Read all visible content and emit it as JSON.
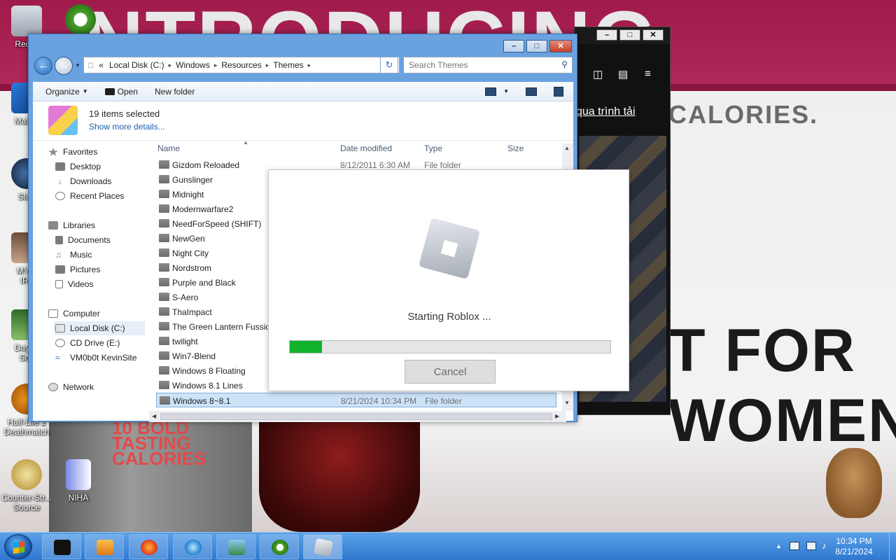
{
  "desktop": {
    "icons": [
      {
        "label": "Recyc",
        "icon": "recycle-bin-icon"
      },
      {
        "label": "Malwa",
        "icon": "malwarebytes-icon"
      },
      {
        "label": "Stea",
        "icon": "steam-icon"
      },
      {
        "label": "MY F\nIRL",
        "icon": "user-photo-icon"
      },
      {
        "label": "Day of\nSou",
        "icon": "day-of-defeat-icon"
      },
      {
        "label": "Half-Life 2\nDeathmatch",
        "icon": "half-life-icon"
      },
      {
        "label": "Counter-Str...\nSource",
        "icon": "counter-strike-icon"
      },
      {
        "label": "NIHA",
        "icon": "file-icon"
      }
    ],
    "wallpaper": {
      "top_text": "NTRODUCING",
      "calories_text": "CALORIES.",
      "for_text": "T FOR",
      "women_text": "WOMEN.",
      "can_text": "10 BOLD\nTASTING\nCALORIES"
    }
  },
  "browser_window": {
    "link_text": "qua trình tải"
  },
  "explorer": {
    "address": {
      "segments": [
        "Local Disk (C:)",
        "Windows",
        "Resources",
        "Themes"
      ],
      "overflow": "«"
    },
    "search_placeholder": "Search Themes",
    "toolbar": {
      "organize": "Organize",
      "open": "Open",
      "new_folder": "New folder"
    },
    "details": {
      "count": "19 items selected",
      "show_more": "Show more details..."
    },
    "nav": {
      "favorites": "Favorites",
      "desktop": "Desktop",
      "downloads": "Downloads",
      "recent": "Recent Places",
      "libraries": "Libraries",
      "documents": "Documents",
      "music": "Music",
      "pictures": "Pictures",
      "videos": "Videos",
      "computer": "Computer",
      "local_disk": "Local Disk (C:)",
      "cd_drive": "CD Drive (E:)",
      "network_share": "VM0b0t KevinSite",
      "network": "Network"
    },
    "columns": {
      "name": "Name",
      "date": "Date modified",
      "type": "Type",
      "size": "Size"
    },
    "files": [
      {
        "name": "Gizdom Reloaded",
        "date": "8/12/2011 6:30 AM",
        "type": "File folder"
      },
      {
        "name": "Gunslinger",
        "date": "",
        "type": ""
      },
      {
        "name": "Midnight",
        "date": "",
        "type": ""
      },
      {
        "name": "Modernwarfare2",
        "date": "",
        "type": ""
      },
      {
        "name": "NeedForSpeed (SHIFT)",
        "date": "",
        "type": ""
      },
      {
        "name": "NewGen",
        "date": "",
        "type": ""
      },
      {
        "name": "Night City",
        "date": "",
        "type": ""
      },
      {
        "name": "Nordstrom",
        "date": "",
        "type": ""
      },
      {
        "name": "Purple and Black",
        "date": "",
        "type": ""
      },
      {
        "name": "S-Aero",
        "date": "",
        "type": ""
      },
      {
        "name": "ThaImpact",
        "date": "",
        "type": ""
      },
      {
        "name": "The Green Lantern Fussion",
        "date": "",
        "type": ""
      },
      {
        "name": "twilight",
        "date": "",
        "type": ""
      },
      {
        "name": "Win7-Blend",
        "date": "",
        "type": ""
      },
      {
        "name": "Windows 8 Floating",
        "date": "",
        "type": ""
      },
      {
        "name": "Windows 8.1 Lines",
        "date": "",
        "type": ""
      },
      {
        "name": "Windows 8~8.1",
        "date": "8/21/2024 10:34 PM",
        "type": "File folder"
      }
    ]
  },
  "roblox_dialog": {
    "status": "Starting Roblox ...",
    "progress": 0.1,
    "cancel_label": "Cancel",
    "progress_color": "#11b32a"
  },
  "taskbar": {
    "apps": [
      {
        "icon": "terminal-icon"
      },
      {
        "icon": "media-player-icon"
      },
      {
        "icon": "firefox-icon"
      },
      {
        "icon": "pinned-app-icon"
      },
      {
        "icon": "photo-viewer-icon"
      },
      {
        "icon": "cc-cleaner-icon"
      },
      {
        "icon": "roblox-icon"
      }
    ],
    "time": "10:34 PM",
    "date": "8/21/2024"
  }
}
